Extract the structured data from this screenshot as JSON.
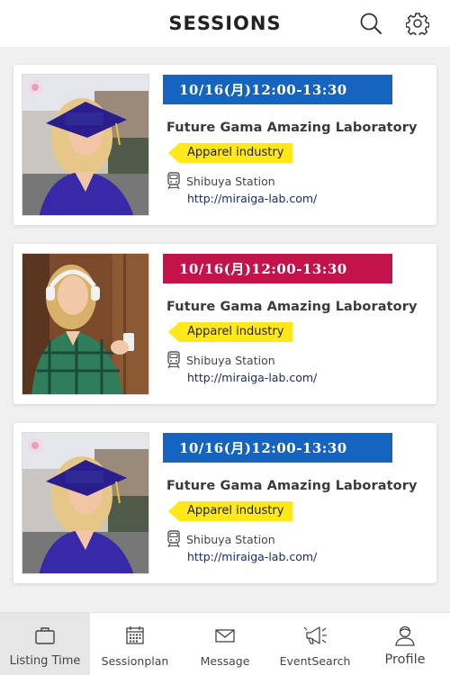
{
  "header": {
    "title": "SESSIONS",
    "search_icon": "search-icon",
    "settings_icon": "gear-icon"
  },
  "sessions": [
    {
      "datetime": "10/16(月)12:00-13:30",
      "datetime_color": "#1565c0",
      "company": "Future Gama Amazing Laboratory",
      "tag": "Apparel industry",
      "station": "Shibuya Station",
      "url": "http://miraiga-lab.com/",
      "photo": "graduate-woman-photo"
    },
    {
      "datetime": "10/16(月)12:00-13:30",
      "datetime_color": "#c2134a",
      "company": "Future Gama Amazing Laboratory",
      "tag": "Apparel industry",
      "station": "Shibuya Station",
      "url": "http://miraiga-lab.com/",
      "photo": "headphones-student-photo"
    },
    {
      "datetime": "10/16(月)12:00-13:30",
      "datetime_color": "#1565c0",
      "company": "Future Gama Amazing Laboratory",
      "tag": "Apparel industry",
      "station": "Shibuya Station",
      "url": "http://miraiga-lab.com/",
      "photo": "graduate-woman-photo"
    }
  ],
  "tabbar": {
    "active": "Listing Time",
    "tabs": [
      {
        "label": "Listing Time",
        "icon": "briefcase-icon"
      },
      {
        "label": "Sessionplan",
        "icon": "calendar-icon"
      },
      {
        "label": "Message",
        "icon": "envelope-icon"
      },
      {
        "label": "EventSearch",
        "icon": "megaphone-icon"
      },
      {
        "label": "Profile",
        "icon": "person-icon"
      }
    ]
  },
  "colors": {
    "accent_blue": "#1565c0",
    "accent_red": "#c2134a",
    "tag_yellow": "#ffe81a"
  }
}
